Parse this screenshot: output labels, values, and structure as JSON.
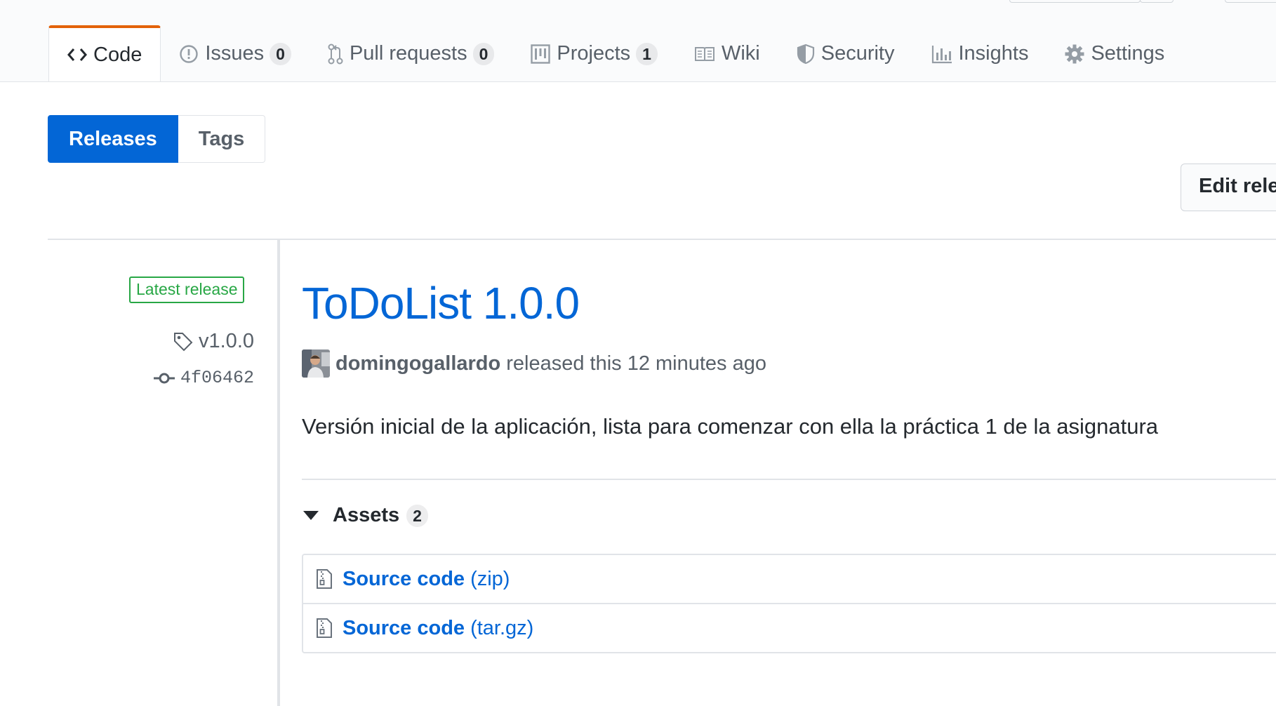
{
  "nav": {
    "tabs": [
      {
        "label": "Code",
        "icon": "code-icon",
        "selected": true
      },
      {
        "label": "Issues",
        "icon": "issue-icon",
        "count": "0"
      },
      {
        "label": "Pull requests",
        "icon": "pull-request-icon",
        "count": "0"
      },
      {
        "label": "Projects",
        "icon": "project-icon",
        "count": "1"
      },
      {
        "label": "Wiki",
        "icon": "book-icon"
      },
      {
        "label": "Security",
        "icon": "shield-icon"
      },
      {
        "label": "Insights",
        "icon": "graph-icon"
      },
      {
        "label": "Settings",
        "icon": "gear-icon"
      }
    ]
  },
  "subnav": {
    "releases_label": "Releases",
    "tags_label": "Tags"
  },
  "actions": {
    "edit_label": "Edit rele"
  },
  "release": {
    "badge": "Latest release",
    "tag": "v1.0.0",
    "commit": "4f06462",
    "title": "ToDoList 1.0.0",
    "author": "domingogallardo",
    "released_text": "released this 12 minutes ago",
    "description": "Versión inicial de la aplicación, lista para comenzar con ella la práctica 1 de la asignatura"
  },
  "assets": {
    "label": "Assets",
    "count": "2",
    "items": [
      {
        "name": "Source code",
        "format": "(zip)",
        "icon": "file-zip-icon"
      },
      {
        "name": "Source code",
        "format": "(tar.gz)",
        "icon": "file-zip-icon"
      }
    ]
  },
  "colors": {
    "link": "#0366d6",
    "tab_accent": "#e36209",
    "latest_badge": "#28a745",
    "primary_button": "#0366d6"
  }
}
